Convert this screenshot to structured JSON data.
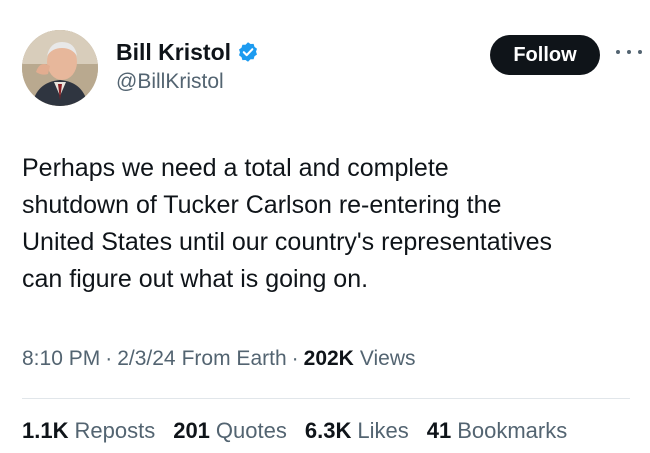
{
  "author": {
    "name": "Bill Kristol",
    "handle": "@BillKristol",
    "verified": true
  },
  "follow_label": "Follow",
  "tweet": {
    "text": "Perhaps we need a total and complete\nshutdown of Tucker Carlson re-entering the\nUnited States until our country's representatives\ncan figure out what is going on."
  },
  "meta": {
    "time": "8:10 PM",
    "date": "2/3/24",
    "source": "From Earth",
    "views_count": "202K",
    "views_label": "Views",
    "separator": "·"
  },
  "stats": [
    {
      "count": "1.1K",
      "label": "Reposts"
    },
    {
      "count": "201",
      "label": "Quotes"
    },
    {
      "count": "6.3K",
      "label": "Likes"
    },
    {
      "count": "41",
      "label": "Bookmarks"
    }
  ],
  "colors": {
    "text_primary": "#0f1419",
    "text_secondary": "#536471",
    "verified_blue": "#1d9bf0",
    "follow_bg": "#0f1419"
  }
}
